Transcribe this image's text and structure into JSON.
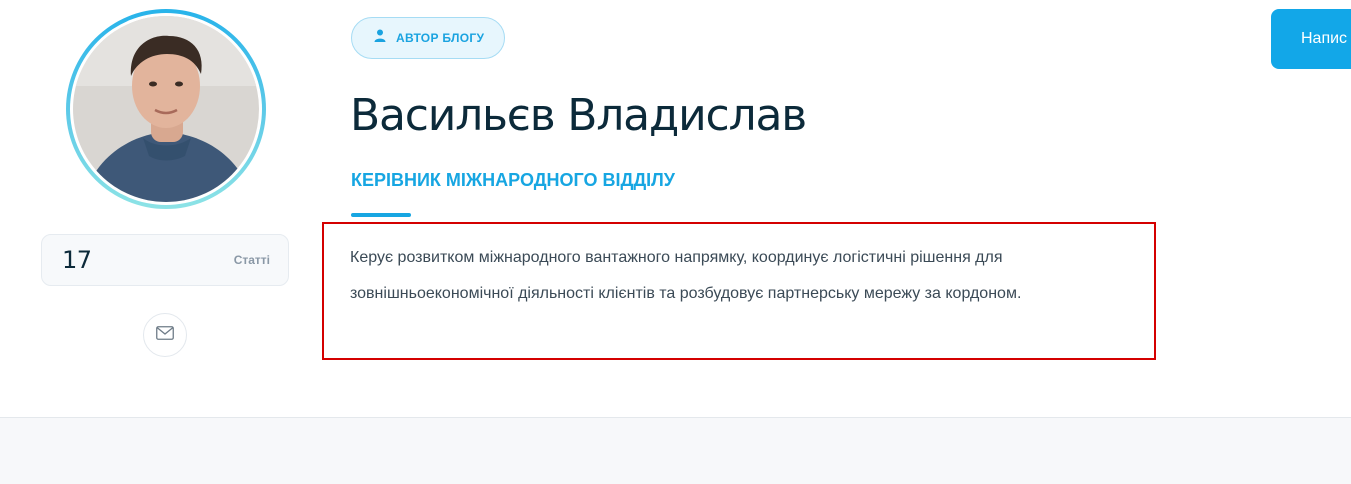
{
  "author": {
    "badge_label": "АВТОР БЛОГУ",
    "name": "Васильєв Владислав",
    "role": "КЕРІВНИК МІЖНАРОДНОГО ВІДДІЛУ",
    "bio": "Керує розвитком міжнародного вантажного напрямку, координує логістичні рішення для зовнішньоекономічної діяльності клієнтів та розбудовує партнерську мережу за кордоном."
  },
  "stats": {
    "articles_count": "17",
    "articles_label": "Статті"
  },
  "header": {
    "write_button_label": "Напис"
  },
  "icons": {
    "badge": "user-icon",
    "contact": "mail-icon"
  },
  "colors": {
    "accent": "#17a6e2",
    "heading": "#0c2a3a",
    "highlight_frame": "#d40000"
  }
}
